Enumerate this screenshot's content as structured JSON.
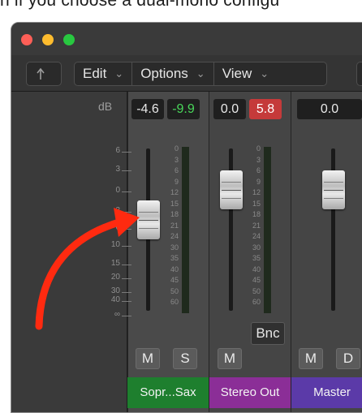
{
  "top_text": "n if you choose a dual-mono configu",
  "toolbar": {
    "back_icon": "back-arrow-icon",
    "edit_label": "Edit",
    "options_label": "Options",
    "view_label": "View",
    "chevron": "⌄"
  },
  "db_header": "dB",
  "scale_labels": [
    "6",
    "3",
    "0",
    "3",
    "6",
    "10",
    "15",
    "20",
    "30",
    "40",
    "∞"
  ],
  "meter_scale": [
    "0",
    "3",
    "6",
    "9",
    "12",
    "15",
    "18",
    "21",
    "24",
    "30",
    "35",
    "40",
    "45",
    "50",
    "60"
  ],
  "strips": [
    {
      "volume": "-4.6",
      "peak": "-9.9",
      "peak_color": "#49d75a",
      "mute_label": "M",
      "solo_label": "S",
      "name": "Sopr...Sax",
      "name_color": "#1e7f2e",
      "fader_level": -4.6
    },
    {
      "volume": "0.0",
      "peak": "5.8",
      "peak_color": "#ffffff",
      "peak_bg": "#c53a3a",
      "mute_label": "M",
      "bounce_label": "Bnc",
      "name": "Stereo Out",
      "name_color": "#8b2e97",
      "fader_level": 0.0
    },
    {
      "volume": "0.0",
      "mute_label": "M",
      "dim_label": "D",
      "name": "Master",
      "name_color": "#5b3aa8",
      "fader_level": 0.0
    }
  ],
  "annotation_color": "#ff2a10"
}
